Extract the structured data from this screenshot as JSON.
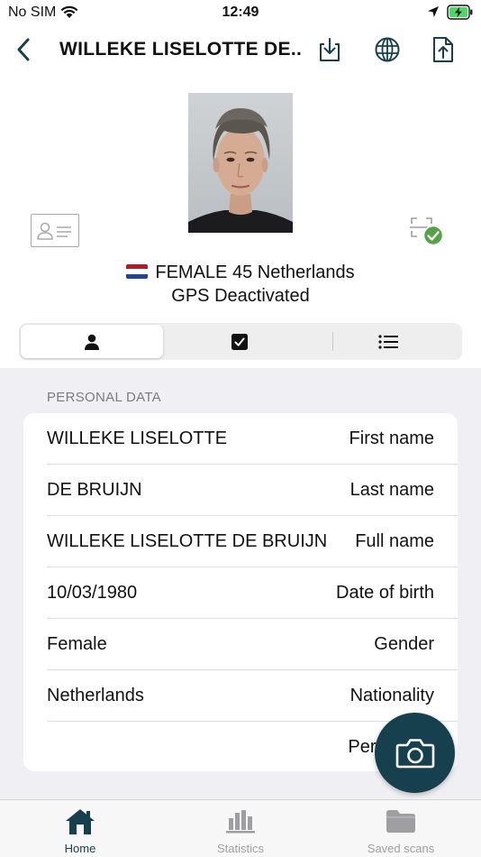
{
  "status_bar": {
    "carrier": "No SIM",
    "time": "12:49"
  },
  "nav": {
    "title": "WILLEKE LISELOTTE DE...",
    "actions": [
      "download-icon",
      "globe-icon",
      "share-icon"
    ]
  },
  "header": {
    "summary": {
      "flag": "Netherlands flag",
      "text": "FEMALE 45 Netherlands"
    },
    "gps_status": "GPS Deactivated"
  },
  "segments": {
    "items": [
      "person-icon",
      "checkbox-icon",
      "list-icon"
    ],
    "selected": 0
  },
  "personal_data": {
    "section_title": "PERSONAL DATA",
    "rows": [
      {
        "value": "WILLEKE LISELOTTE",
        "label": "First name"
      },
      {
        "value": "DE BRUIJN",
        "label": "Last name"
      },
      {
        "value": "WILLEKE LISELOTTE DE BRUIJN",
        "label": "Full name"
      },
      {
        "value": "10/03/1980",
        "label": "Date of birth"
      },
      {
        "value": "Female",
        "label": "Gender"
      },
      {
        "value": "Netherlands",
        "label": "Nationality"
      },
      {
        "value": "",
        "label": "Personal n"
      }
    ]
  },
  "tab_bar": {
    "tabs": [
      {
        "label": "Home",
        "icon": "home-icon",
        "active": true
      },
      {
        "label": "Statistics",
        "icon": "bar-chart-icon",
        "active": false
      },
      {
        "label": "Saved scans",
        "icon": "folder-icon",
        "active": false
      }
    ]
  },
  "colors": {
    "accent": "#17404f",
    "inactive_tab": "#9e9ea3",
    "success": "#52a447",
    "background_grouped": "#f0f0f4"
  }
}
